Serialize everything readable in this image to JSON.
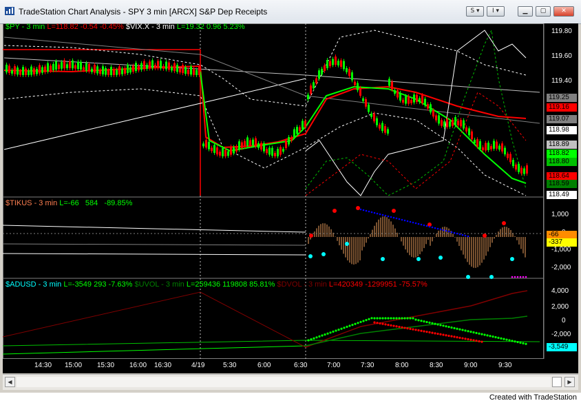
{
  "window": {
    "title": "TradeStation Chart Analysis - SPY 3 min [ARCX] S&P Dep Receipts"
  },
  "titlebar_buttons": {
    "s_label": "S",
    "i_label": "I"
  },
  "panels": {
    "spy": {
      "symbol": "$PY - 3 min",
      "last": "L=118.82",
      "chg": "-0.54",
      "pct": "-0.45%",
      "vix_symbol": "$VIX.X - 3 min",
      "vix_last": "L=19.32",
      "vix_chg": "0.96",
      "vix_pct": "5.23%",
      "axis_ticks": [
        "119.80",
        "119.60",
        "119.40"
      ],
      "price_boxes": [
        {
          "value": "119.25",
          "bg": "#808080",
          "fg": "#000000"
        },
        {
          "value": "119.16",
          "bg": "#ff0000",
          "fg": "#000000"
        },
        {
          "value": "119.07",
          "bg": "#808080",
          "fg": "#000000"
        },
        {
          "value": "118.98",
          "bg": "#ffffff",
          "fg": "#000000"
        },
        {
          "value": "118.89",
          "bg": "#c0c0c0",
          "fg": "#000000"
        },
        {
          "value": "118.82",
          "bg": "#00ff00",
          "fg": "#000000"
        },
        {
          "value": "118.80",
          "bg": "#00c000",
          "fg": "#000000"
        },
        {
          "value": "118.64",
          "bg": "#ff0000",
          "fg": "#000000"
        },
        {
          "value": "118.59",
          "bg": "#008000",
          "fg": "#000000"
        },
        {
          "value": "118.49",
          "bg": "#ffffff",
          "fg": "#000000"
        }
      ]
    },
    "tikus": {
      "symbol": "$TIKUS - 3 min",
      "last": "L=-66",
      "chg": "584",
      "pct": "-89.85%",
      "axis_ticks": [
        "1,000",
        "0",
        "-1,000",
        "-2,000"
      ],
      "price_boxes": [
        {
          "value": "-66",
          "bg": "#ff8c00",
          "fg": "#000000"
        },
        {
          "value": "-337",
          "bg": "#ffff00",
          "fg": "#000000"
        }
      ]
    },
    "adusd": {
      "symbol": "$ADUSD - 3 min",
      "last": "L=-3549",
      "chg": "293",
      "pct": "-7.63%",
      "uvol_symbol": "$UVOL - 3 min",
      "uvol_last": "L=259436",
      "uvol_chg": "119808",
      "uvol_pct": "85.81%",
      "dvol_symbol": "$DVOL - 3 min",
      "dvol_last": "L=420349",
      "dvol_chg": "-1299951",
      "dvol_pct": "-75.57%",
      "axis_ticks": [
        "4,000",
        "2,000",
        "0",
        "-2,000"
      ],
      "price_boxes": [
        {
          "value": "-3,549",
          "bg": "#00ffff",
          "fg": "#000000"
        }
      ]
    }
  },
  "time_axis": [
    "14:30",
    "15:00",
    "15:30",
    "16:00",
    "16:30",
    "4/19",
    "5:30",
    "6:00",
    "6:30",
    "7:00",
    "7:30",
    "8:00",
    "8:30",
    "9:00",
    "9:30"
  ],
  "colors": {
    "up": "#00ff00",
    "down": "#ff0000",
    "symbol": "#00ff00",
    "tikus": "#ff7f50",
    "adusd": "#00ffff",
    "dvol": "#ff0000"
  },
  "footer": "Created with TradeStation"
}
